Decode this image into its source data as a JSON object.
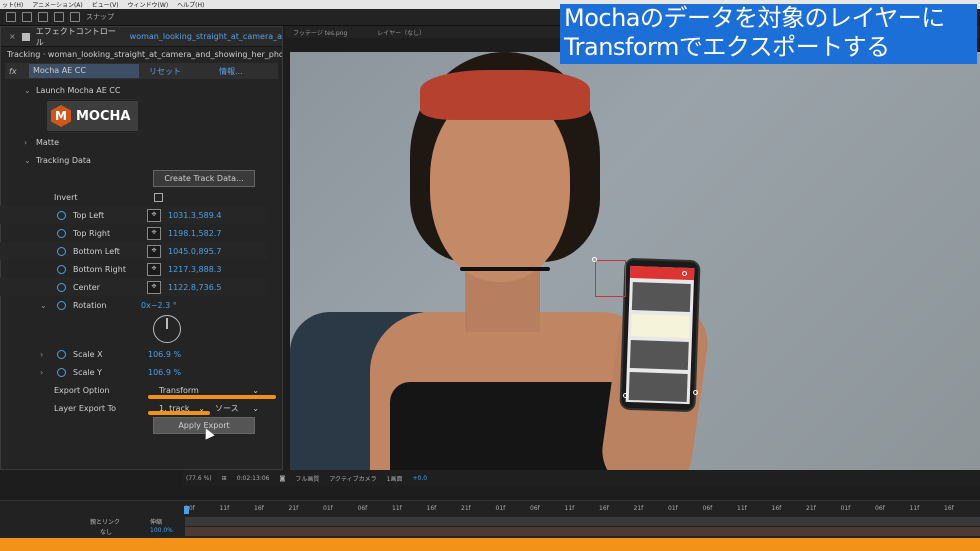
{
  "menubar": {
    "items": [
      "ット(H)",
      "アニメーション(A)",
      "ビュー(V)",
      "ウィンドウ(W)",
      "ヘルプ(H)"
    ]
  },
  "toolbar": {
    "snap_label": "スナップ"
  },
  "effect_controls": {
    "tab_label": "エフェクトコントロール",
    "layer_name": "woman_looking_straight_at_camera_a",
    "path": "Tracking · woman_looking_straight_at_camera_and_showing_her_phone_",
    "fx_label": "fx",
    "effect_name": "Mocha AE CC",
    "reset": "リセット",
    "about": "情報...",
    "launch_label": "Launch Mocha AE CC",
    "logo_letter": "M",
    "logo_text": "MOCHA",
    "matte_label": "Matte",
    "tracking_data_label": "Tracking Data",
    "create_track_data": "Create Track Data...",
    "invert_label": "Invert",
    "params": [
      {
        "label": "Top Left",
        "value": "1031.3,589.4"
      },
      {
        "label": "Top Right",
        "value": "1198.1,582.7"
      },
      {
        "label": "Bottom Left",
        "value": "1045.0,895.7"
      },
      {
        "label": "Bottom Right",
        "value": "1217.3,888.3"
      },
      {
        "label": "Center",
        "value": "1122.8,736.5"
      }
    ],
    "rotation_label": "Rotation",
    "rotation_value": "0x−2.3 °",
    "scale_x_label": "Scale X",
    "scale_x_value": "106.9 %",
    "scale_y_label": "Scale Y",
    "scale_y_value": "106.9 %",
    "export_option_label": "Export Option",
    "export_option_value": "Transform",
    "layer_export_label": "Layer Export To",
    "layer_export_value": "1. track",
    "source_value": "ソース",
    "apply_export": "Apply Export"
  },
  "composition": {
    "footage_tab": "フッテージ tes.png",
    "layer_tab": "レイヤー（なし）"
  },
  "title_overlay": {
    "line1": "Mochaのデータを対象のレイヤーに",
    "line2": "Transformでエクスポートする"
  },
  "viewer_toolbar": {
    "zoom": "(77.6 %)",
    "timecode": "0:02:13:06",
    "quality": "フル画質",
    "camera": "アクティブカメラ",
    "views": "1画面",
    "exposure": "+0.0"
  },
  "timeline": {
    "ruler_labels": [
      "10f",
      "11f",
      "16f",
      "21f",
      "01f",
      "06f",
      "11f",
      "16f",
      "21f",
      "01f",
      "06f",
      "11f",
      "16f",
      "21f",
      "01f",
      "06f",
      "11f",
      "16f",
      "21f",
      "01f",
      "06f",
      "11f",
      "16f"
    ],
    "parent_label": "親とリンク",
    "stretch_label": "伸縮",
    "parent_value": "なし",
    "stretch_value": "100.0%"
  },
  "colors": {
    "accent": "#f39219",
    "title_bg": "#1d6fd8",
    "link_blue": "#4aa0e6"
  }
}
